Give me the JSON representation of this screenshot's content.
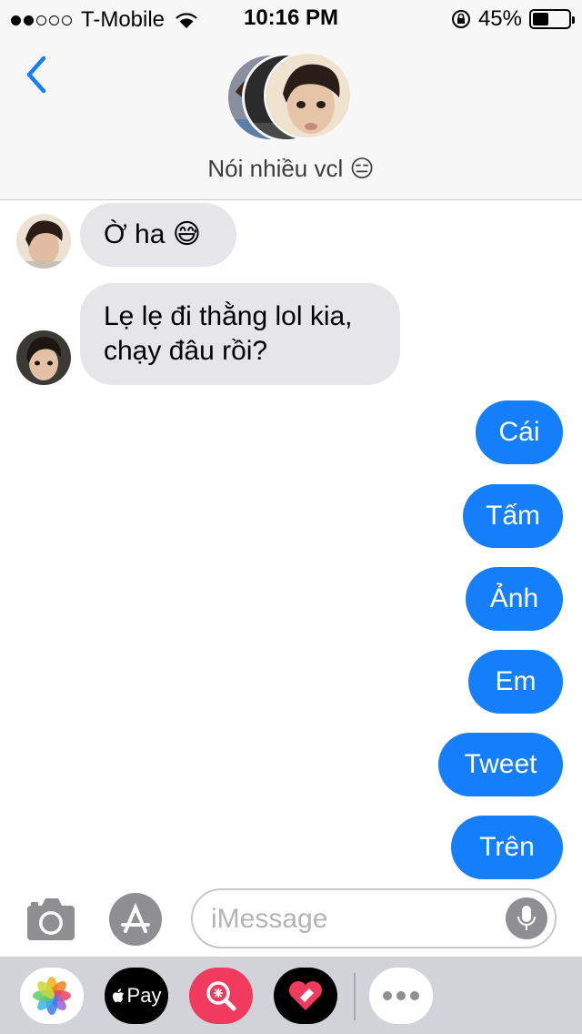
{
  "status_bar": {
    "carrier": "T-Mobile",
    "time": "10:16 PM",
    "battery_percent": "45%",
    "battery_level": 0.45,
    "signal_bars_filled": 2,
    "signal_bars_total": 5
  },
  "header": {
    "group_name": "Nói nhiều vcl 😑"
  },
  "messages": [
    {
      "direction": "incoming",
      "text": "Ờ ha 😅"
    },
    {
      "direction": "incoming",
      "text": "Lẹ lẹ đi thằng lol kia,\nchạy đâu rồi?"
    },
    {
      "direction": "outgoing",
      "text": "Cái"
    },
    {
      "direction": "outgoing",
      "text": "Tấm"
    },
    {
      "direction": "outgoing",
      "text": "Ảnh"
    },
    {
      "direction": "outgoing",
      "text": "Em"
    },
    {
      "direction": "outgoing",
      "text": "Tweet"
    },
    {
      "direction": "outgoing",
      "text": "Trên"
    }
  ],
  "input": {
    "placeholder": "iMessage",
    "value": ""
  },
  "app_drawer": {
    "apps": [
      "photos-icon",
      "apple-pay-icon",
      "image-search-icon",
      "digital-touch-icon",
      "more-icon"
    ],
    "apple_pay_label": "Pay"
  },
  "colors": {
    "accent": "#147efb",
    "incoming_bubble": "#e5e5ea",
    "drawer_background": "#d1d3d9"
  }
}
